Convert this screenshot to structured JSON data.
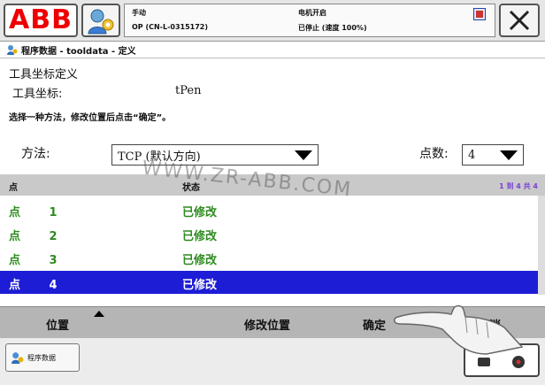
{
  "header": {
    "logo_text": "ABB",
    "status": {
      "mode": "手动",
      "controller": "OP (CN-L-0315172)",
      "motor_state": "电机开启",
      "run_state": "已停止 (速度 100%)"
    }
  },
  "breadcrumb": "程序数据 - tooldata - 定义",
  "main": {
    "title": "工具坐标定义",
    "tool_label": "工具坐标:",
    "tool_value": "tPen",
    "instruction": "选择一种方法，修改位置后点击“确定”。",
    "method_label": "方法:",
    "method_value": "TCP (默认方向)",
    "count_label": "点数:",
    "count_value": "4"
  },
  "table": {
    "headers": [
      "点",
      "状态"
    ],
    "pager": "1 到 4 共 4",
    "rows": [
      {
        "point": "点 1",
        "status": "已修改"
      },
      {
        "point": "点 2",
        "status": "已修改"
      },
      {
        "point": "点 3",
        "status": "已修改"
      },
      {
        "point": "点 4",
        "status": "已修改"
      }
    ],
    "selected_index": 3
  },
  "actions": {
    "position": "位置",
    "modify_position": "修改位置",
    "ok": "确定",
    "cancel": "取消"
  },
  "footer": {
    "task_label": "程序数据"
  },
  "watermark": "WWW.ZR-ABB.COM",
  "colors": {
    "logo_red": "#e00000",
    "status_green": "#2e8b1f",
    "selected_row": "#1d1dd6",
    "pager_purple": "#7a3fd8"
  }
}
